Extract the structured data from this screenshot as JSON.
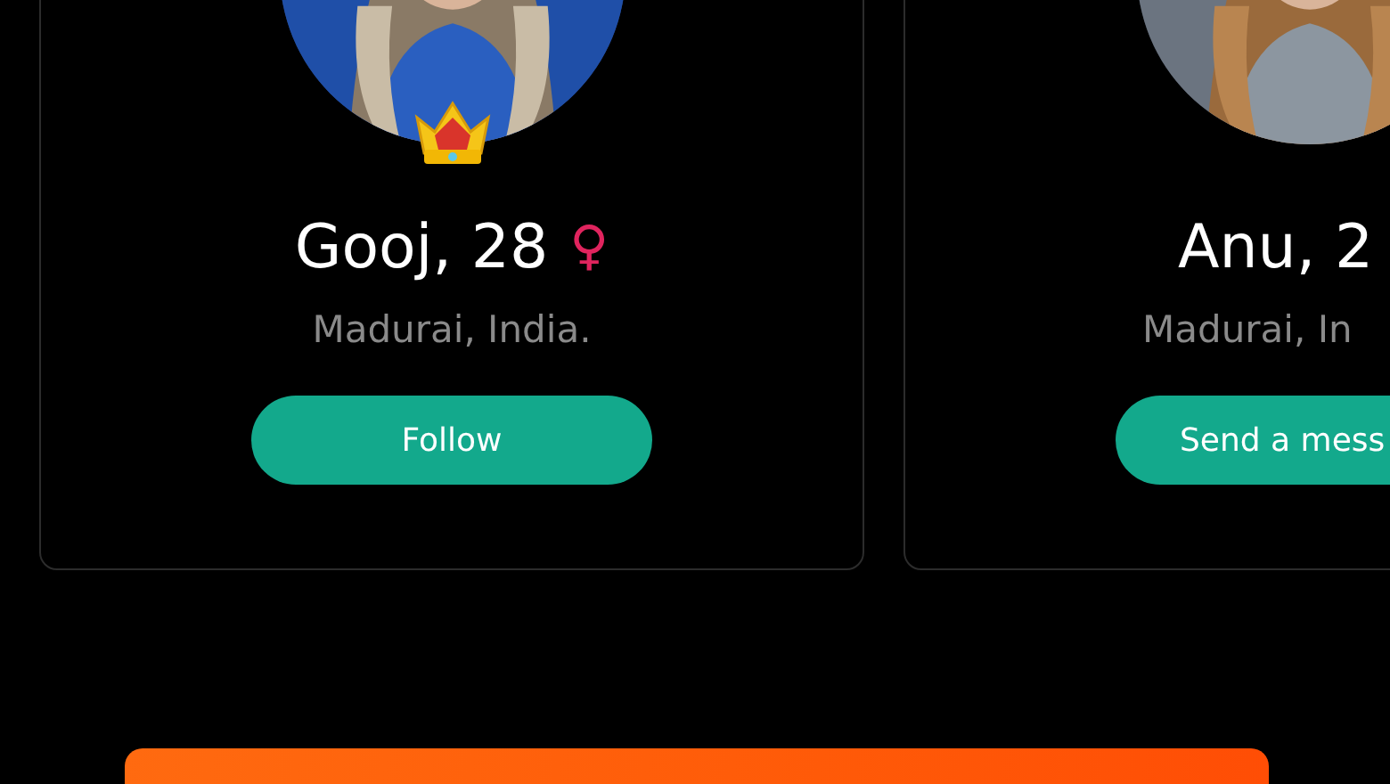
{
  "profiles": [
    {
      "premium": true,
      "name": "Gooj, 28",
      "gender_icon": "♀",
      "location": "Madurai, India.",
      "action": "Follow"
    },
    {
      "premium": false,
      "name": "Anu, 2",
      "location": "Madurai, In",
      "action": "Send a mess"
    }
  ]
}
